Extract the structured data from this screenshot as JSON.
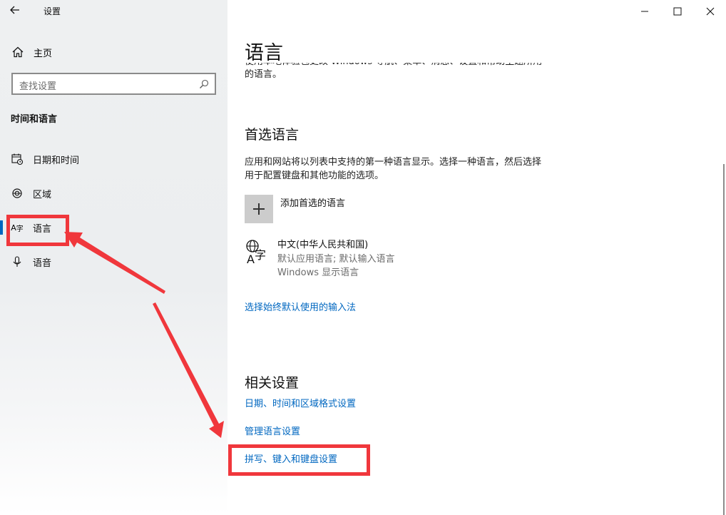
{
  "window": {
    "title": "设置",
    "controls": {
      "minimize": "minimize-icon",
      "maximize": "maximize-icon",
      "close": "close-icon"
    }
  },
  "sidebar": {
    "home_label": "主页",
    "search_placeholder": "查找设置",
    "section_title": "时间和语言",
    "items": [
      {
        "label": "日期和时间",
        "icon": "calendar-clock-icon"
      },
      {
        "label": "区域",
        "icon": "globe-icon"
      },
      {
        "label": "语言",
        "icon": "language-icon",
        "active": true
      },
      {
        "label": "语音",
        "icon": "microphone-icon"
      }
    ]
  },
  "main": {
    "title": "语言",
    "intro": [
      "使用本地体验包更改 Windows 导航、菜单、消息、设置和帮助主题所用",
      "的语言。"
    ],
    "preferred": {
      "heading": "首选语言",
      "description": [
        "应用和网站将以列表中支持的第一种语言显示。选择一种语言，然后选择",
        "用于配置键盘和其他功能的选项。"
      ],
      "add_label": "添加首选的语言",
      "language": {
        "name": "中文(中华人民共和国)",
        "details": [
          "默认应用语言; 默认输入语言",
          "Windows 显示语言"
        ]
      },
      "input_method_link": "选择始终默认使用的输入法"
    },
    "related": {
      "heading": "相关设置",
      "links": [
        "日期、时间和区域格式设置",
        "管理语言设置",
        "拼写、键入和键盘设置"
      ]
    }
  },
  "annotations": {
    "color": "#f0373c"
  },
  "colors": {
    "accent": "#0067c0",
    "sidebar_bg": "#eef0f1",
    "annotation": "#f0373c"
  }
}
